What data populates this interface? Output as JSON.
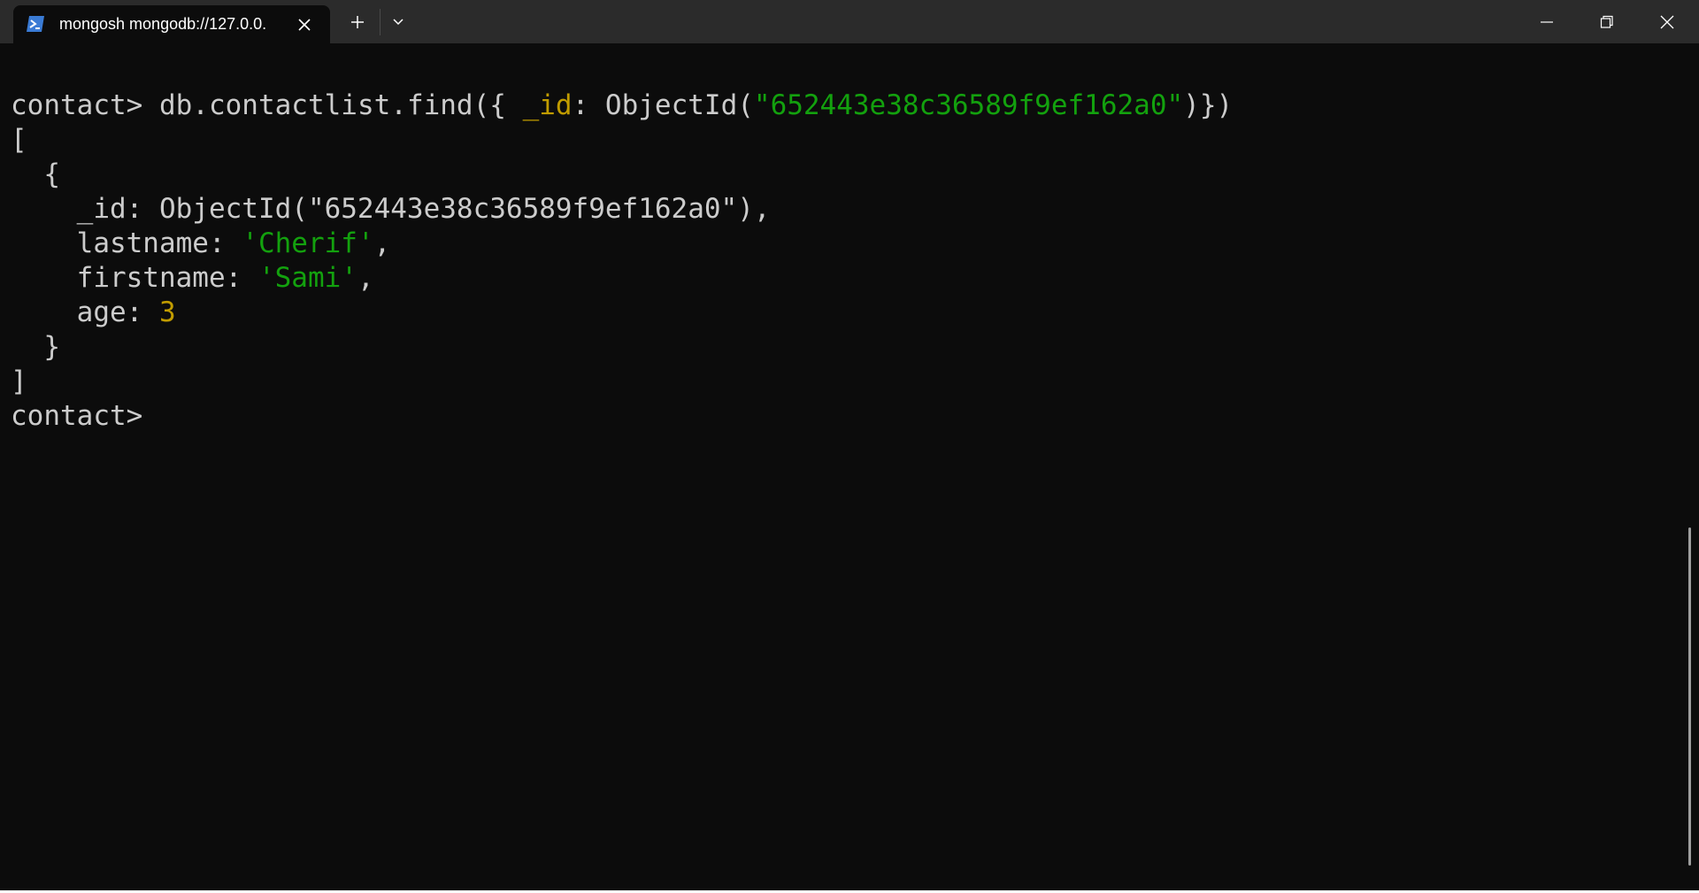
{
  "window": {
    "tab_title": "mongosh mongodb://127.0.0.",
    "tab_icon": "powershell-icon",
    "colors": {
      "background": "#0c0c0c",
      "titlebar": "#2b2b2b",
      "text": "#cccccc",
      "string": "#13a10e",
      "number_key": "#c19c00"
    }
  },
  "terminal": {
    "command": {
      "prompt": "contact> ",
      "part1": "db.contactlist.find({ ",
      "key": "_id",
      "part2": ": ObjectId(",
      "value": "\"652443e38c36589f9ef162a0\"",
      "part3": ")})"
    },
    "output": {
      "open_bracket": "[",
      "open_brace": "  {",
      "id_line": "    _id: ObjectId(\"652443e38c36589f9ef162a0\"),",
      "lastname_key": "    lastname: ",
      "lastname_value": "'Cherif'",
      "lastname_comma": ",",
      "firstname_key": "    firstname: ",
      "firstname_value": "'Sami'",
      "firstname_comma": ",",
      "age_key": "    age: ",
      "age_value": "3",
      "close_brace": "  }",
      "close_bracket": "]"
    },
    "final_prompt": "contact>"
  }
}
